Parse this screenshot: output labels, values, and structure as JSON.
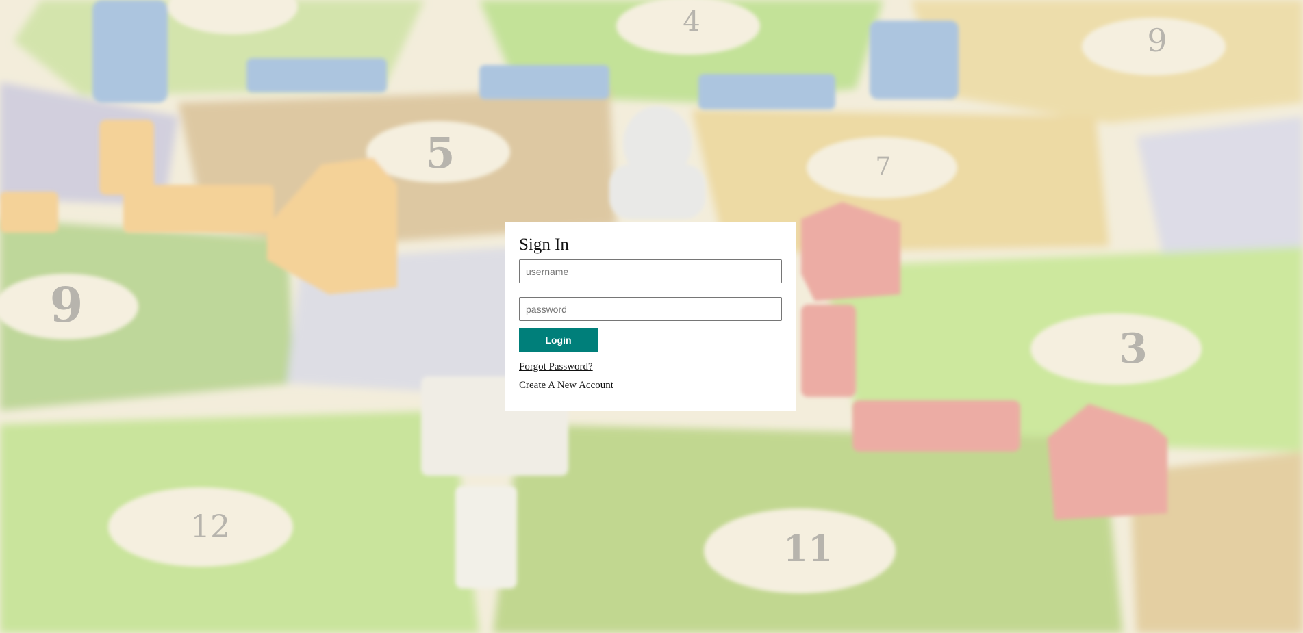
{
  "background": {
    "description_icon": "board-game-background",
    "number_tokens": [
      "9",
      "5",
      "3",
      "12",
      "11",
      "4",
      "9",
      "7"
    ]
  },
  "signin": {
    "title": "Sign In",
    "username_placeholder": "username",
    "password_placeholder": "password",
    "login_label": "Login",
    "forgot_password_label": "Forgot Password?",
    "create_account_label": "Create A New Account"
  },
  "colors": {
    "accent": "#007f7a",
    "card_background": "#ffffff"
  }
}
